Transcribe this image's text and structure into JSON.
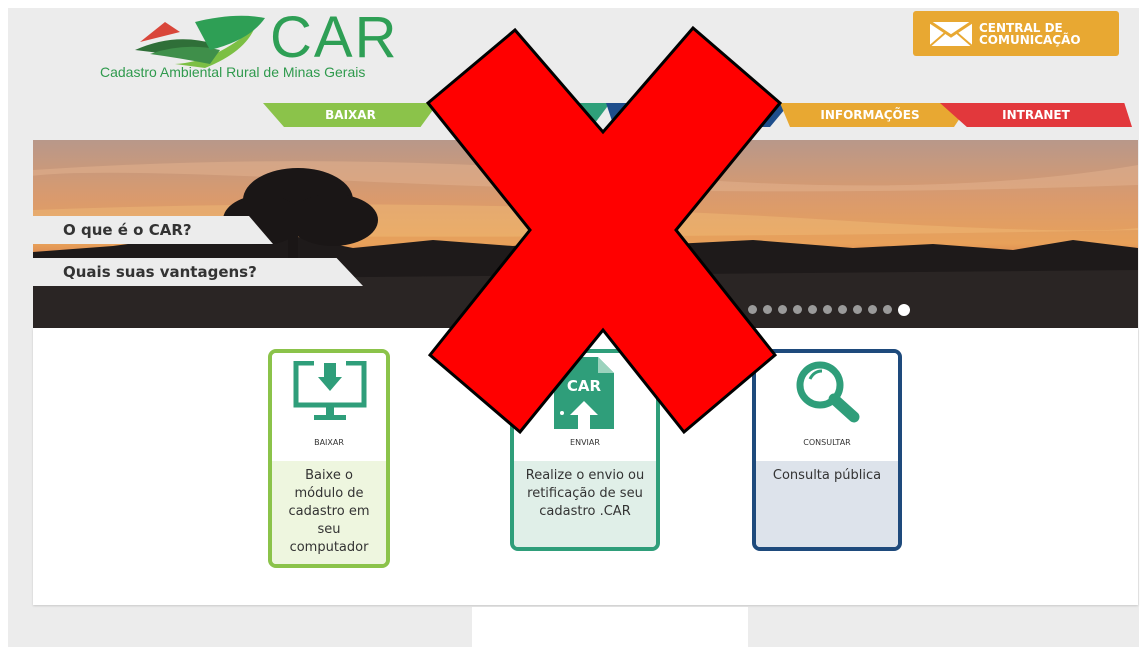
{
  "header": {
    "logo_text": "CAR",
    "logo_subtitle": "Cadastro Ambiental Rural de Minas Gerais",
    "central_line1": "CENTRAL DE",
    "central_line2": "COMUNICAÇÃO"
  },
  "nav": {
    "tabs": [
      {
        "label": "BAIXAR",
        "color": "#8bc34a"
      },
      {
        "label": "",
        "color": "#2fa07a"
      },
      {
        "label": "",
        "color": "#1e4e8c"
      },
      {
        "label": "INFORMAÇÕES",
        "color": "#e8a832"
      },
      {
        "label": "INTRANET",
        "color": "#e2383c"
      }
    ]
  },
  "banner": {
    "question1": "O que é o CAR?",
    "question2": "Quais suas vantagens?",
    "slide_count": 11,
    "active_slide": 11
  },
  "cards": [
    {
      "title": "BAIXAR",
      "desc": "Baixe o módulo de cadastro em seu computador",
      "icon": "monitor-download-icon",
      "color": "#8bc34a"
    },
    {
      "title": "ENVIAR",
      "desc": "Realize o envio ou retificação de seu cadastro .CAR",
      "icon": "car-file-upload-icon",
      "icon_text": "CAR",
      "color": "#2f9e7a"
    },
    {
      "title": "CONSULTAR",
      "desc": "Consulta pública",
      "icon": "magnifier-icon",
      "color": "#1e4a7c"
    }
  ],
  "overlay": {
    "icon": "red-x-icon",
    "color": "#ff0000"
  }
}
